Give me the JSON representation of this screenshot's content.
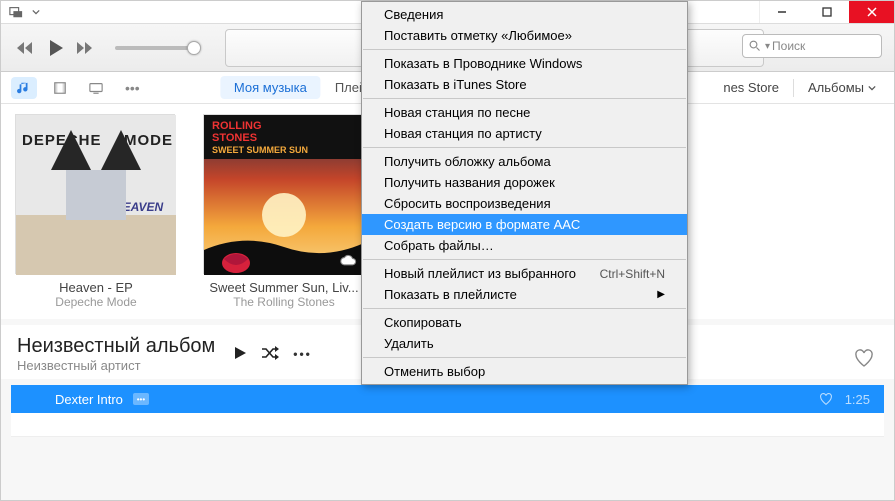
{
  "search": {
    "placeholder": "Поиск"
  },
  "viewbar": {
    "tabs": {
      "my_music": "Моя музыка",
      "playlists": "Плейли"
    },
    "store_link": "nes Store",
    "view_drop": "Альбомы"
  },
  "albums": [
    {
      "title": "Heaven - EP",
      "artist": "Depeche Mode"
    },
    {
      "title": "Sweet Summer Sun, Liv...",
      "artist": "The Rolling Stones"
    }
  ],
  "selected_album": {
    "title": "Неизвестный альбом",
    "artist": "Неизвестный артист"
  },
  "track": {
    "name": "Dexter Intro",
    "duration": "1:25"
  },
  "menu": {
    "info": "Сведения",
    "mark_fav": "Поставить отметку «Любимое»",
    "show_explorer": "Показать в Проводнике Windows",
    "show_store": "Показать в iTunes Store",
    "station_song": "Новая станция по песне",
    "station_artist": "Новая станция по артисту",
    "get_artwork": "Получить обложку альбома",
    "get_tracknames": "Получить названия дорожек",
    "reset_plays": "Сбросить воспроизведения",
    "create_aac": "Создать версию в формате AAC",
    "consolidate": "Собрать файлы…",
    "new_playlist": "Новый плейлист из выбранного",
    "new_playlist_shortcut": "Ctrl+Shift+N",
    "show_in_playlist": "Показать в плейлисте",
    "copy": "Скопировать",
    "delete": "Удалить",
    "deselect": "Отменить выбор"
  }
}
